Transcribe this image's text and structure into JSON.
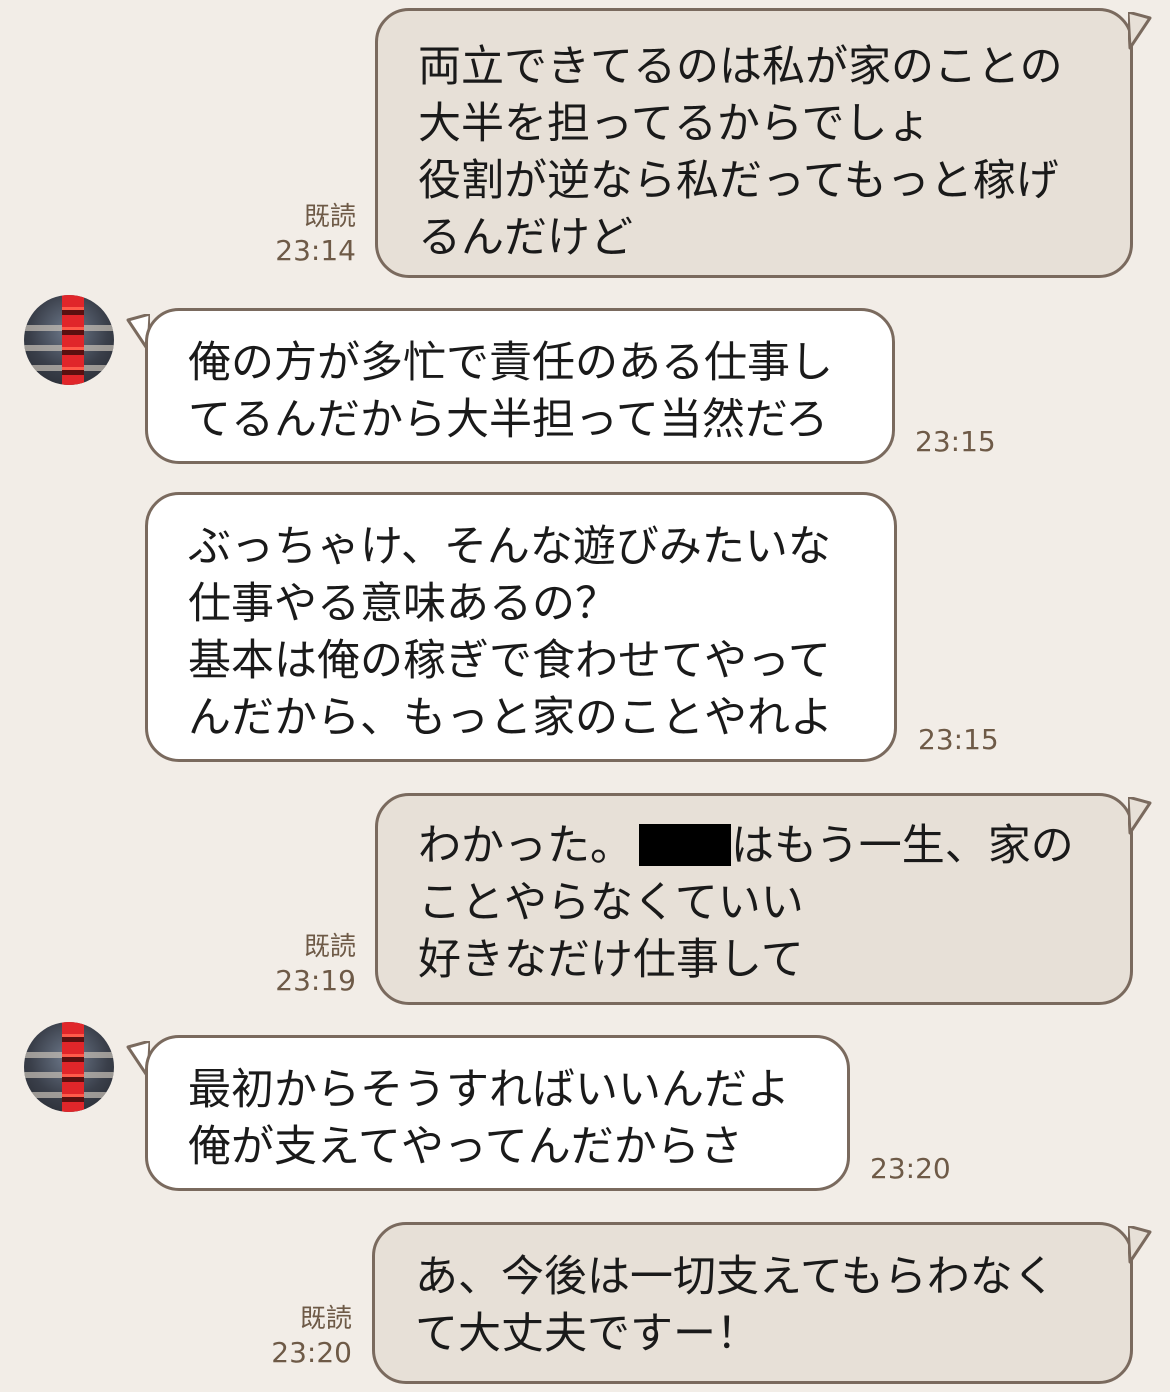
{
  "messages": [
    {
      "id": "m1",
      "direction": "outgoing",
      "lines": [
        "両立できてるのは私が家のことの",
        "大半を担ってるからでしょ",
        "役割が逆なら私だってもっと稼げ",
        "るんだけど"
      ],
      "read": "既読",
      "time": "23:14"
    },
    {
      "id": "m2",
      "direction": "incoming",
      "lines": [
        "俺の方が多忙で責任のある仕事し",
        "てるんだから大半担って当然だろ"
      ],
      "time": "23:15"
    },
    {
      "id": "m3",
      "direction": "incoming",
      "lines": [
        "ぶっちゃけ、そんな遊びみたいな",
        "仕事やる意味あるの？",
        "基本は俺の稼ぎで食わせてやって",
        "んだから、もっと家のことやれよ"
      ],
      "time": "23:15"
    },
    {
      "id": "m4",
      "direction": "outgoing",
      "line1_pre": "わかった。",
      "line1_post": "はもう一生、家の",
      "lines_rest": [
        "ことやらなくていい",
        "好きなだけ仕事して"
      ],
      "read": "既読",
      "time": "23:19"
    },
    {
      "id": "m5",
      "direction": "incoming",
      "lines": [
        "最初からそうすればいいんだよ",
        "俺が支えてやってんだからさ"
      ],
      "time": "23:20"
    },
    {
      "id": "m6",
      "direction": "outgoing",
      "lines": [
        "あ、今後は一切支えてもらわなく",
        "て大丈夫ですー！"
      ],
      "read": "既読",
      "time": "23:20"
    }
  ],
  "colors": {
    "background": "#f2ede7",
    "outgoing_bubble": "#e7e0d7",
    "incoming_bubble": "#ffffff",
    "bubble_border": "#7a6a5e",
    "meta_text": "#6e5a47"
  },
  "avatar_icon": "contact-avatar-icon",
  "redaction_icon": "redacted-name-block"
}
